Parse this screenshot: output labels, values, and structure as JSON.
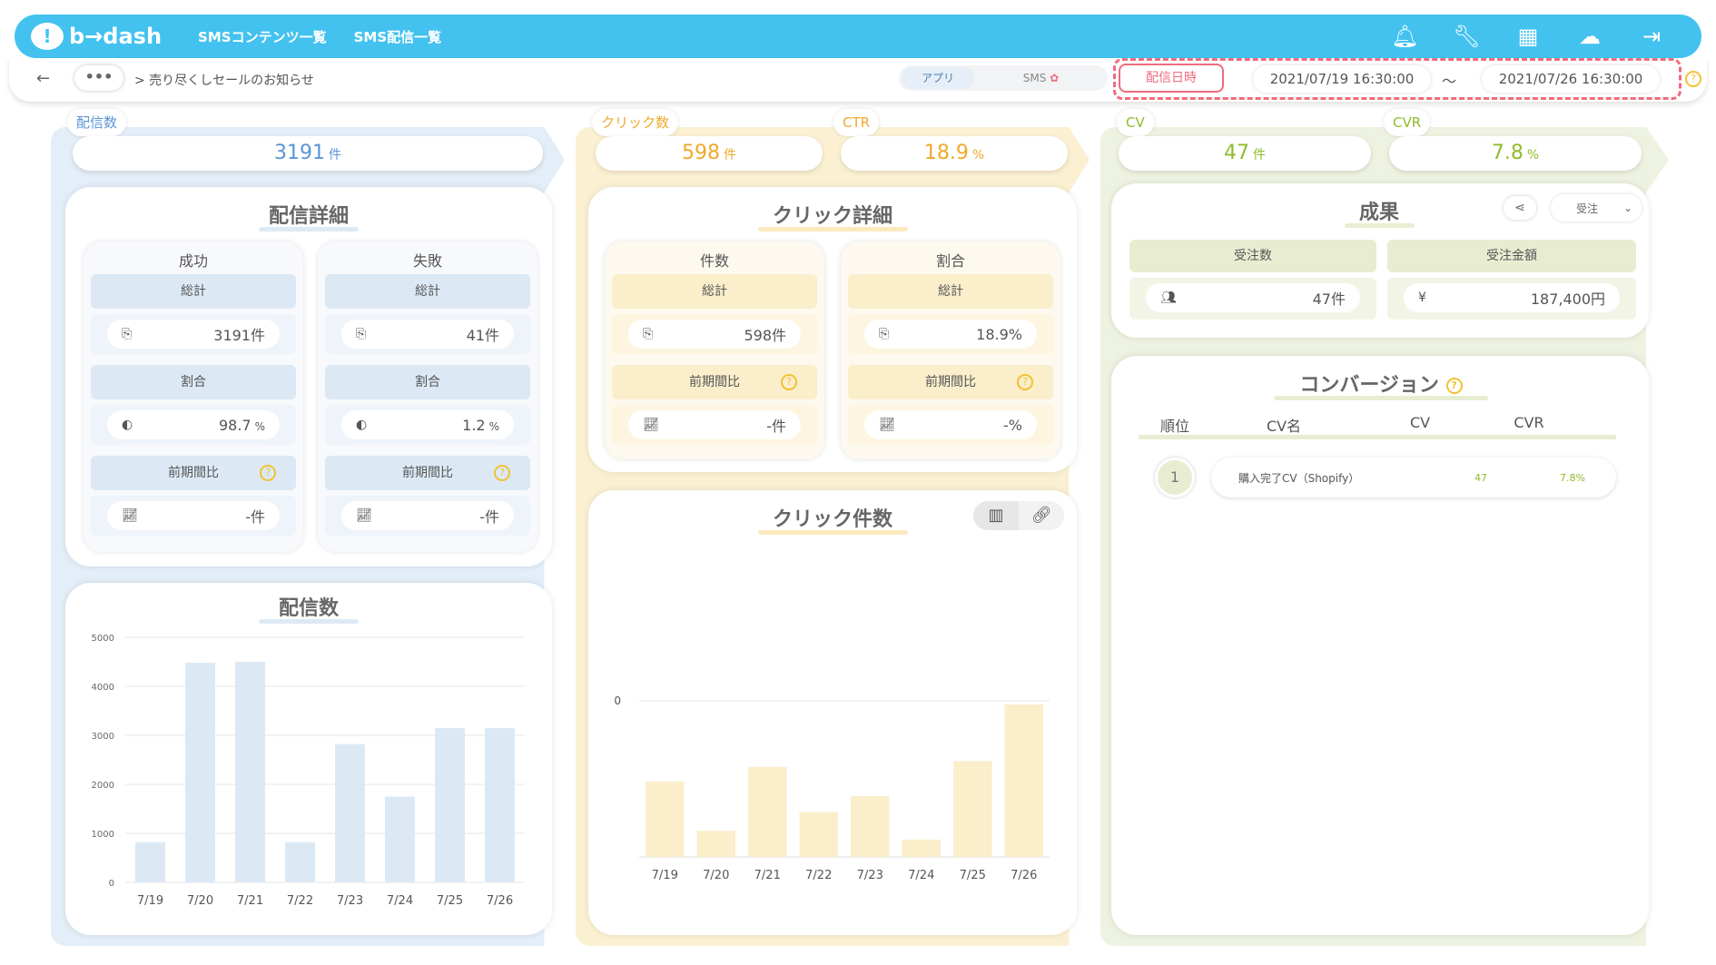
{
  "topbar": {
    "logo": "b→dash",
    "nav": [
      "SMSコンテンツ一覧",
      "SMS配信一覧"
    ],
    "icons": [
      "bell-icon",
      "wrench-icon",
      "apps-grid-icon",
      "support-icon",
      "logout-icon"
    ]
  },
  "subbar": {
    "back": "←",
    "more": "•••",
    "breadcrumb": "> 売り尽くしセールのお知らせ",
    "channel_app": "アプリ",
    "channel_sms": "SMS",
    "datetime_label": "配信日時",
    "date_from": "2021/07/19 16:30:00",
    "tilde": "〜",
    "date_to": "2021/07/26 16:30:00",
    "help": "?"
  },
  "delivery": {
    "kpi_label": "配信数",
    "kpi_value": "3191",
    "kpi_unit": "件",
    "detail_title": "配信詳細",
    "success": {
      "title": "成功",
      "total_label": "総計",
      "total": "3191件",
      "ratio_label": "割合",
      "ratio": "98.7",
      "ratio_unit": "%",
      "prev_label": "前期間比",
      "prev": "-件"
    },
    "failure": {
      "title": "失敗",
      "total_label": "総計",
      "total": "41件",
      "ratio_label": "割合",
      "ratio": "1.2",
      "ratio_unit": "%",
      "prev_label": "前期間比",
      "prev": "-件"
    },
    "chart_title": "配信数"
  },
  "click": {
    "kpi_label": "クリック数",
    "kpi_value": "598",
    "kpi_unit": "件",
    "ctr_label": "CTR",
    "ctr_value": "18.9",
    "ctr_unit": "%",
    "detail_title": "クリック詳細",
    "count": {
      "title": "件数",
      "total_label": "総計",
      "total": "598件",
      "prev_label": "前期間比",
      "prev": "-件"
    },
    "ratio": {
      "title": "割合",
      "total_label": "総計",
      "total": "18.9%",
      "prev_label": "前期間比",
      "prev": "-%"
    },
    "chart_title": "クリック件数"
  },
  "cv": {
    "kpi_label": "CV",
    "kpi_value": "47",
    "kpi_unit": "件",
    "cvr_label": "CVR",
    "cvr_value": "7.8",
    "cvr_unit": "%",
    "result_title": "成果",
    "result_select": "受注",
    "orders_label": "受注数",
    "orders_value": "47件",
    "amount_label": "受注金額",
    "amount_value": "187,400円",
    "conversion_title": "コンバージョン",
    "table_headers": [
      "順位",
      "CV名",
      "CV",
      "CVR"
    ],
    "rows": [
      {
        "rank": "1",
        "name": "購入完了CV（Shopify）",
        "cv": "47",
        "cvr": "7.8%"
      }
    ]
  },
  "chart_data": [
    {
      "type": "bar",
      "title": "配信数",
      "categories": [
        "7/19",
        "7/20",
        "7/21",
        "7/22",
        "7/23",
        "7/24",
        "7/25",
        "7/26"
      ],
      "values": [
        820,
        4480,
        4500,
        820,
        2820,
        1750,
        3150,
        3150
      ],
      "yticks": [
        "0",
        "1000",
        "2000",
        "3000",
        "4000",
        "5000"
      ],
      "ylim": [
        0,
        5000
      ],
      "color": "#dce9f5",
      "grid": true
    },
    {
      "type": "bar",
      "title": "クリック件数",
      "categories": [
        "7/19",
        "7/20",
        "7/21",
        "7/22",
        "7/23",
        "7/24",
        "7/25",
        "7/26"
      ],
      "values": [
        52,
        18,
        62,
        31,
        42,
        12,
        66,
        105
      ],
      "yticks": [
        "0"
      ],
      "color": "#faeecb",
      "grid": true
    }
  ],
  "colors": {
    "blue": "#5a95d6",
    "yellow": "#f0a92a",
    "green": "#8fbc2c",
    "topbar": "#43c2f0",
    "alert": "#ef6c7e"
  }
}
